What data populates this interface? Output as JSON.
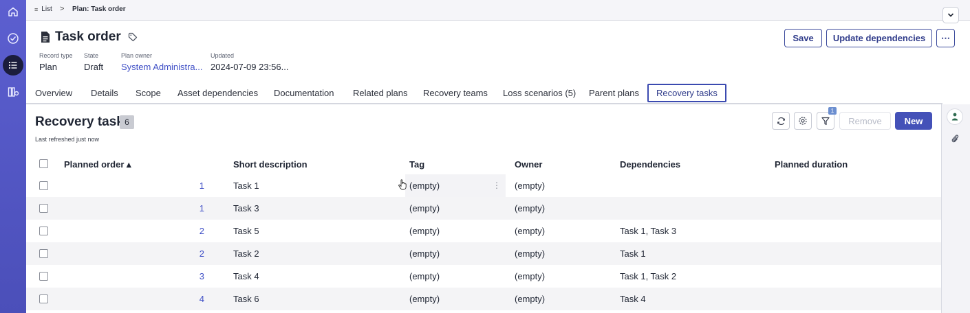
{
  "breadcrumb": {
    "list_label": "List",
    "separator": ">",
    "current": "Plan: Task order"
  },
  "header": {
    "title": "Task order",
    "buttons": {
      "save": "Save",
      "update_dependencies": "Update dependencies",
      "more": "⋯"
    },
    "meta": [
      {
        "label": "Record type",
        "value": "Plan"
      },
      {
        "label": "State",
        "value": "Draft"
      },
      {
        "label": "Plan owner",
        "value": "System Administra..."
      },
      {
        "label": "Updated",
        "value": "2024-07-09 23:56..."
      }
    ]
  },
  "tabs": [
    {
      "label": "Overview"
    },
    {
      "label": "Details"
    },
    {
      "label": "Scope"
    },
    {
      "label": "Asset dependencies"
    },
    {
      "label": "Documentation"
    },
    {
      "label": "Related plans"
    },
    {
      "label": "Recovery teams"
    },
    {
      "label": "Loss scenarios (5)"
    },
    {
      "label": "Parent plans"
    },
    {
      "label": "Recovery tasks",
      "active": true
    }
  ],
  "list": {
    "title": "Recovery task",
    "count": "6",
    "refreshed": "Last refreshed just now",
    "filter_badge": "1",
    "remove_label": "Remove",
    "new_label": "New",
    "columns": [
      "Planned order ▴",
      "Short description",
      "Tag",
      "Owner",
      "Dependencies",
      "Planned duration"
    ],
    "rows": [
      {
        "order": "1",
        "description": "Task 1",
        "tag": "(empty)",
        "owner": "(empty)",
        "dependencies": "",
        "duration": ""
      },
      {
        "order": "1",
        "description": "Task 3",
        "tag": "(empty)",
        "owner": "(empty)",
        "dependencies": "",
        "duration": ""
      },
      {
        "order": "2",
        "description": "Task 5",
        "tag": "(empty)",
        "owner": "(empty)",
        "dependencies": "Task 1, Task 3",
        "duration": ""
      },
      {
        "order": "2",
        "description": "Task 2",
        "tag": "(empty)",
        "owner": "(empty)",
        "dependencies": "Task 1",
        "duration": ""
      },
      {
        "order": "3",
        "description": "Task 4",
        "tag": "(empty)",
        "owner": "(empty)",
        "dependencies": "Task 1, Task 2",
        "duration": ""
      },
      {
        "order": "4",
        "description": "Task 6",
        "tag": "(empty)",
        "owner": "(empty)",
        "dependencies": "Task 4",
        "duration": ""
      }
    ]
  },
  "colors": {
    "rail": "#5c5fd0",
    "accent": "#3f4fc6",
    "primary_button": "#4451b8"
  },
  "icons": {
    "rail": [
      "home-icon",
      "check-circle-icon",
      "list-icon",
      "workspace-icon"
    ],
    "header": [
      "document-icon",
      "tag-icon",
      "chevron-down-icon"
    ],
    "toolbar": [
      "refresh-icon",
      "gear-icon",
      "filter-icon"
    ],
    "right_rail": [
      "person-icon",
      "paperclip-icon"
    ]
  }
}
